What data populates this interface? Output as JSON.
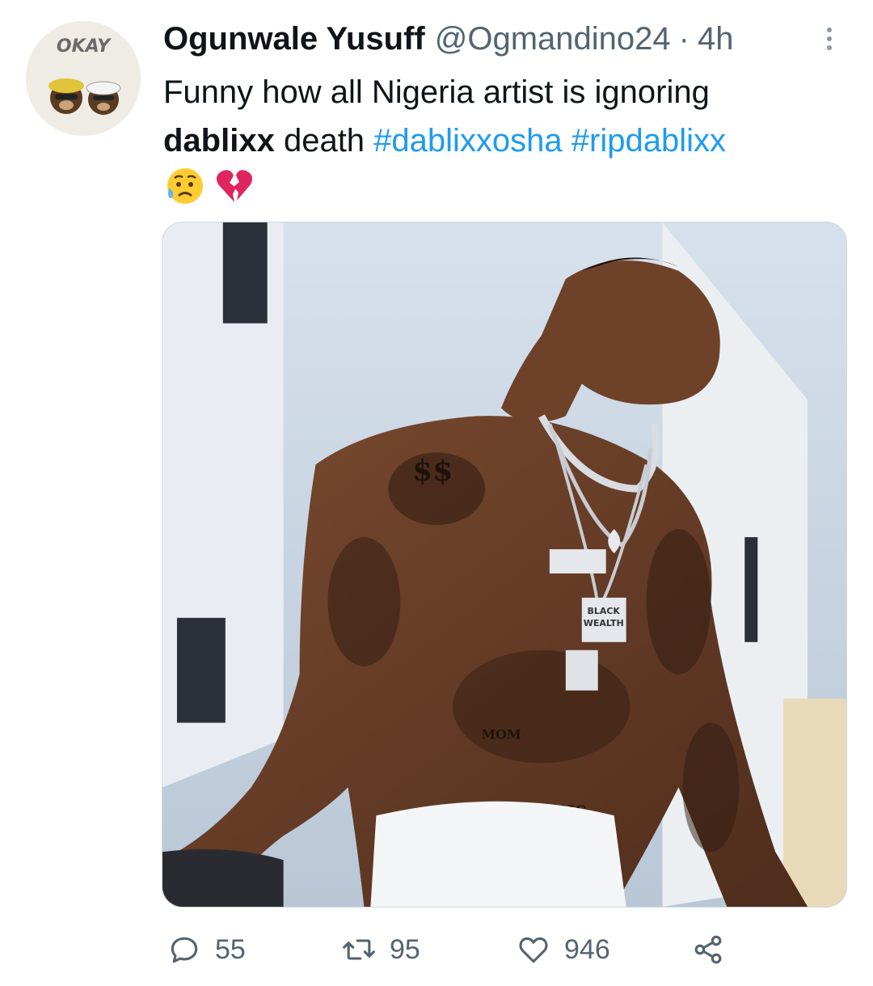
{
  "tweet": {
    "author": {
      "name": "Ogunwale Yusuff",
      "handle": "@Ogmandino24",
      "avatar_text": "OKAY"
    },
    "separator": "·",
    "time": "4h",
    "text": {
      "line1": "Funny how all Nigeria artist is ignoring",
      "bold_word": "dablixx",
      "word_death": " death ",
      "hashtag1": "#dablixxosha",
      "hashtag2": "#ripdablixx"
    },
    "emojis": [
      "sad-but-relieved-face-icon",
      "broken-heart-icon"
    ],
    "media": {
      "type": "photo",
      "tattoo_text": [
        "$$",
        "BLACK",
        "WEALTH",
        "MOM",
        "MUSIC"
      ]
    },
    "stats": {
      "replies": "55",
      "retweets": "95",
      "likes": "946"
    }
  },
  "colors": {
    "text": "#0f1419",
    "secondary": "#536471",
    "link": "#1d9bf0",
    "border": "#cfd9de"
  }
}
